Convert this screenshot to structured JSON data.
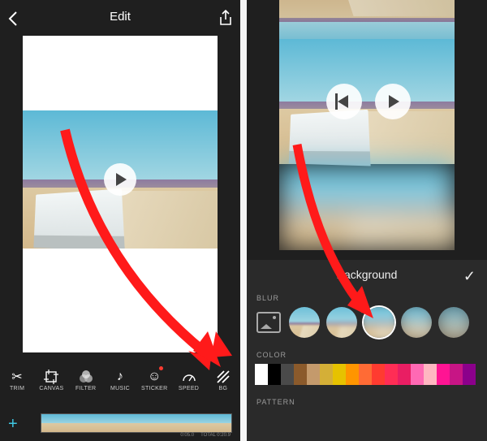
{
  "screen1": {
    "title": "Edit",
    "tools": [
      {
        "label": "TRIM",
        "icon": "scissors"
      },
      {
        "label": "CANVAS",
        "icon": "crop"
      },
      {
        "label": "FILTER",
        "icon": "overlap"
      },
      {
        "label": "MUSIC",
        "icon": "note"
      },
      {
        "label": "STICKER",
        "icon": "smiley",
        "badge": true
      },
      {
        "label": "SPEED",
        "icon": "gauge"
      },
      {
        "label": "BG",
        "icon": "hatch"
      }
    ],
    "timeline_current": "0:05.0",
    "timeline_total": "TOTAL 0:20.9"
  },
  "screen2": {
    "panel_title": "Background",
    "sections": [
      "BLUR",
      "COLOR",
      "PATTERN"
    ],
    "blur_options": 5,
    "blur_selected": 2,
    "colors": [
      "#ffffff",
      "#000000",
      "#4a4a4a",
      "#8b5a2b",
      "#c49a6c",
      "#d4af37",
      "#e6c200",
      "#ff9500",
      "#ff6b35",
      "#ff3b30",
      "#ff2d55",
      "#e91e63",
      "#ff69b4",
      "#ffb6c1",
      "#ff1493",
      "#c71585",
      "#8b008b"
    ]
  }
}
